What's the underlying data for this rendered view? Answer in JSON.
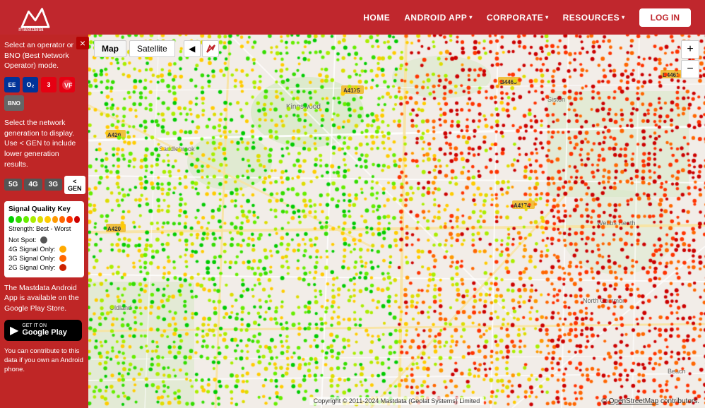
{
  "header": {
    "logo_alt": "Mastdata",
    "nav": [
      {
        "label": "HOME",
        "dropdown": false
      },
      {
        "label": "ANDROID APP",
        "dropdown": true
      },
      {
        "label": "CORPORATE",
        "dropdown": true
      },
      {
        "label": "RESOURCES",
        "dropdown": true
      }
    ],
    "login_label": "LOG IN"
  },
  "sidebar": {
    "close_label": "×",
    "operator_text": "Select an operator or BNO (Best Network Operator) mode.",
    "generation_text": "Select the network generation to display. Use < GEN to include lower generation results.",
    "operators": [
      {
        "id": "ee",
        "label": "EE",
        "color": "#003399"
      },
      {
        "id": "o2",
        "label": "O2",
        "color": "#003399"
      },
      {
        "id": "three",
        "label": "3",
        "color": "#e60012"
      },
      {
        "id": "voda",
        "label": "VF",
        "color": "#e60012"
      },
      {
        "id": "bno",
        "label": "BNO",
        "color": "#555"
      }
    ],
    "generations": [
      {
        "label": "5G",
        "active": false
      },
      {
        "label": "4G",
        "active": false
      },
      {
        "label": "3G",
        "active": false
      },
      {
        "label": "< GEN",
        "active": true,
        "special": true
      }
    ],
    "signal_key": {
      "title": "Signal Quality Key",
      "dots": [
        "#00cc00",
        "#33dd00",
        "#66ee00",
        "#aaee00",
        "#dddd00",
        "#ffcc00",
        "#ff9900",
        "#ff6600",
        "#ff3300",
        "#cc0000"
      ],
      "strength_label": "Strength: Best - Worst",
      "rows": [
        {
          "label": "Not Spot:",
          "color": "#555555"
        },
        {
          "label": "4G Signal Only:",
          "color": "#ffaa00"
        },
        {
          "label": "3G Signal Only:",
          "color": "#ff6600"
        },
        {
          "label": "2G Signal Only:",
          "color": "#cc2200"
        }
      ]
    },
    "app_text": "The Mastdata Android App is available on the Google Play Store.",
    "google_play": {
      "get_it_on": "GET IT ON",
      "store_name": "Google Play"
    },
    "contribute_text": "You can contribute to this data if you own an Android phone."
  },
  "map": {
    "tabs": [
      {
        "label": "Map",
        "active": true
      },
      {
        "label": "Satellite",
        "active": false
      }
    ],
    "zoom_plus": "+",
    "zoom_minus": "−",
    "attribution": "Copyright © 2011-2024 Mastdata (Geolat Systems) Limited",
    "copyright": "© OpenStreetMap contributors."
  }
}
